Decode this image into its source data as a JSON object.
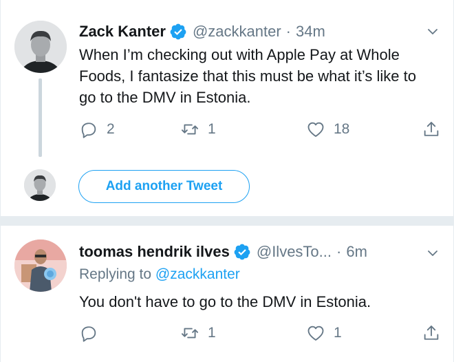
{
  "tweet1": {
    "author_name": "Zack Kanter",
    "author_handle": "@zackkanter",
    "separator_dot": "·",
    "time": "34m",
    "text": "When I’m checking out with Apple Pay at Whole Foods, I fantasize that this must be what it’s like to go to the DMV in Estonia.",
    "reply_count": "2",
    "retweet_count": "1",
    "like_count": "18"
  },
  "thread_reply": {
    "button_label": "Add another Tweet"
  },
  "tweet2": {
    "author_name": "toomas hendrik ilves",
    "author_handle": "@IlvesTo...",
    "separator_dot": "·",
    "time": "6m",
    "replying_prefix": "Replying to",
    "replying_handle": "@zackkanter",
    "text": "You don't have to go to the DMV in Estonia.",
    "reply_count": "",
    "retweet_count": "1",
    "like_count": "1"
  },
  "colors": {
    "accent": "#1da1f2",
    "secondary_text": "#657786",
    "primary_text": "#14171a",
    "divider": "#e6ecf0"
  },
  "icons": [
    "verified-badge-icon",
    "chevron-down-icon",
    "reply-icon",
    "retweet-icon",
    "like-icon",
    "share-icon"
  ]
}
